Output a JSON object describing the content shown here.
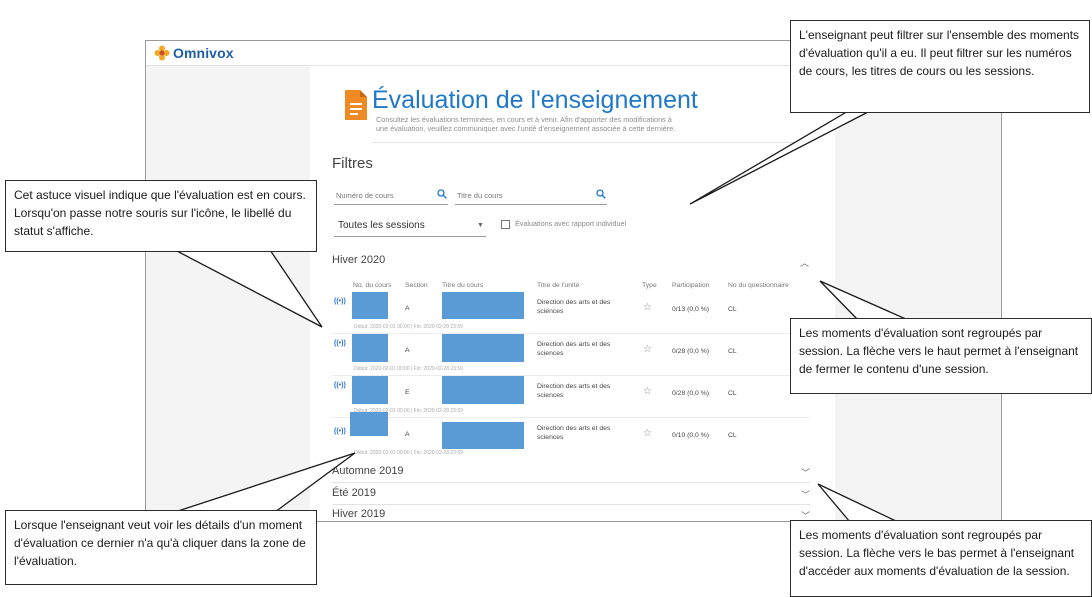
{
  "app": {
    "brand": "Omnivox"
  },
  "page": {
    "title": "Évaluation de l'enseignement",
    "description_line1": "Consultez les évaluations terminées, en cours et à venir. Afin d'apporter des modifications à",
    "description_line2": "une évaluation, veuillez communiquer avec l'unité d'enseignement associée à cette dernière."
  },
  "filters": {
    "title": "Filtres",
    "course_number_placeholder": "Numéro de cours",
    "course_title_placeholder": "Titre du cours",
    "session_select": "Toutes les sessions",
    "checkbox_label": "Évaluations avec rapport individuel"
  },
  "columns": [
    "No. du cours",
    "Section",
    "Titre du cours",
    "Titre de l'unité",
    "Type",
    "Participation",
    "No du questionnaire"
  ],
  "sessions": [
    {
      "name": "Hiver 2020",
      "expanded": true
    },
    {
      "name": "Automne 2019",
      "expanded": false
    },
    {
      "name": "Été 2019",
      "expanded": false
    },
    {
      "name": "Hiver 2019",
      "expanded": false
    }
  ],
  "evaluations": [
    {
      "section": "A",
      "unit": "Direction des arts et des sciences",
      "participation": "0/13 (0,0 %)",
      "questionnaire": "CL",
      "dates": "Début: 2020-02-01 00:00 | Fin: 2020-02-28 23:59"
    },
    {
      "section": "A",
      "unit": "Direction des arts et des sciences",
      "participation": "0/28 (0,0 %)",
      "questionnaire": "CL",
      "dates": "Début: 2020-02-01 00:00 | Fin: 2020-02-28 23:59"
    },
    {
      "section": "E",
      "unit": "Direction des arts et des sciences",
      "participation": "0/28 (0,0 %)",
      "questionnaire": "CL",
      "dates": "Début: 2020-02-01 00:00 | Fin: 2020-02-28 23:59"
    },
    {
      "section": "A",
      "unit": "Direction des arts et des sciences",
      "participation": "0/10 (0,0 %)",
      "questionnaire": "CL",
      "dates": "Début: 2020-02-01 00:00 | Fin: 2020-02-28 23:59"
    }
  ],
  "callouts": {
    "filter": "L'enseignant peut filtrer sur l'ensemble des moments d'évaluation qu'il a eu. Il peut filtrer sur les numéros de cours, les titres de cours ou les sessions.",
    "status": "Cet astuce visuel indique que l'évaluation est en cours. Lorsqu'on passe notre souris sur l'icône, le libellé du statut s'affiche.",
    "collapse": "Les moments d'évaluation sont regroupés par session. La flèche vers le haut permet à l'enseignant de fermer le contenu d'une session.",
    "details": "Lorsque l'enseignant veut voir les détails d'un moment d'évaluation ce dernier n'a qu'à cliquer dans la zone de l'évaluation.",
    "expand": "Les moments d'évaluation sont regroupés par session. La flèche vers le bas permet à l'enseignant d'accéder aux moments d'évaluation de la session."
  },
  "colors": {
    "accent": "#1f78c8",
    "brand": "#1f5fa8",
    "page_icon": "#f08a24",
    "redaction": "#5b9bd5"
  },
  "icons": {
    "logo": "flower-logo-icon",
    "page": "document-icon",
    "search": "search-icon",
    "status": "live-broadcast-icon",
    "type": "star-icon"
  }
}
